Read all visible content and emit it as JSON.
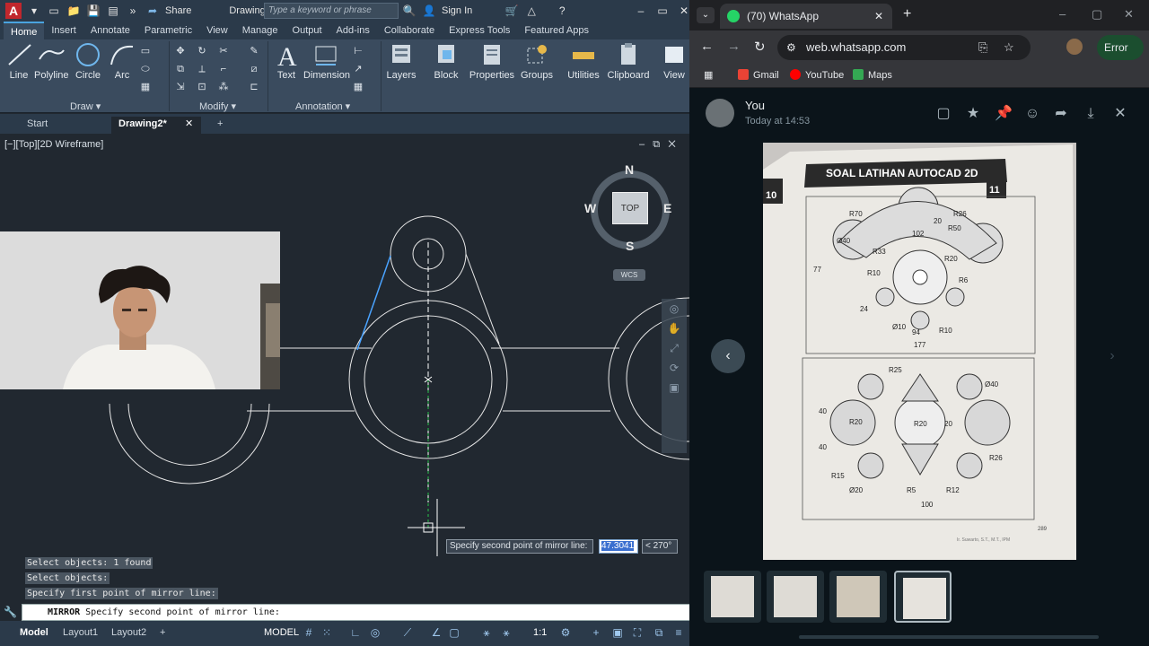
{
  "autocad": {
    "title_doc": "Drawing2...",
    "share_label": "Share",
    "search_placeholder": "Type a keyword or phrase",
    "sign_in": "Sign In",
    "ribbon_tabs": [
      "Home",
      "Insert",
      "Annotate",
      "Parametric",
      "View",
      "Manage",
      "Output",
      "Add-ins",
      "Collaborate",
      "Express Tools",
      "Featured Apps"
    ],
    "draw_tools": [
      "Line",
      "Polyline",
      "Circle",
      "Arc"
    ],
    "big_tools": [
      "Text",
      "Dimension",
      "Layers",
      "Block",
      "Properties",
      "Groups",
      "Utilities",
      "Clipboard",
      "View"
    ],
    "panels": {
      "draw": "Draw",
      "modify": "Modify",
      "annotation": "Annotation"
    },
    "file_tabs": {
      "start": "Start",
      "drawing": "Drawing2*"
    },
    "viewport_label": "[−][Top][2D Wireframe]",
    "viewcube": {
      "n": "N",
      "s": "S",
      "e": "E",
      "w": "W",
      "top": "TOP",
      "wcs": "WCS"
    },
    "tooltip_prompt": "Specify second point of mirror line:",
    "tooltip_value": "47.3041",
    "tooltip_angle": "< 270°",
    "command_history": [
      "Select objects: 1 found",
      "Select objects:",
      "Specify first point of mirror line:"
    ],
    "command_name": "MIRROR",
    "command_prompt": "Specify second point of mirror line:",
    "layout_tabs": [
      "Model",
      "Layout1",
      "Layout2"
    ],
    "status_model": "MODEL",
    "status_scale": "1:1"
  },
  "browser": {
    "tab_title": "(70) WhatsApp",
    "url": "web.whatsapp.com",
    "error_label": "Error",
    "bookmarks": [
      "Gmail",
      "YouTube",
      "Maps"
    ],
    "sender": "You",
    "timestamp": "Today at 14:53",
    "photo": {
      "header": "SOAL LATIHAN AUTOCAD 2D",
      "page_left": "10",
      "page_right": "11",
      "top_dims": [
        "R70",
        "R26",
        "Ø40",
        "R50",
        "R33",
        "R20",
        "R10",
        "R6",
        "Ø10",
        "R10",
        "94",
        "177",
        "77",
        "24",
        "20",
        "102"
      ],
      "bottom_dims": [
        "R25",
        "Ø40",
        "R20",
        "R20",
        "R26",
        "R15",
        "Ø20",
        "R5",
        "R12",
        "100",
        "40",
        "40",
        "20"
      ],
      "footer": "Ir. Suwarto, S.T., M.T., IPM",
      "page_num": "289"
    }
  }
}
